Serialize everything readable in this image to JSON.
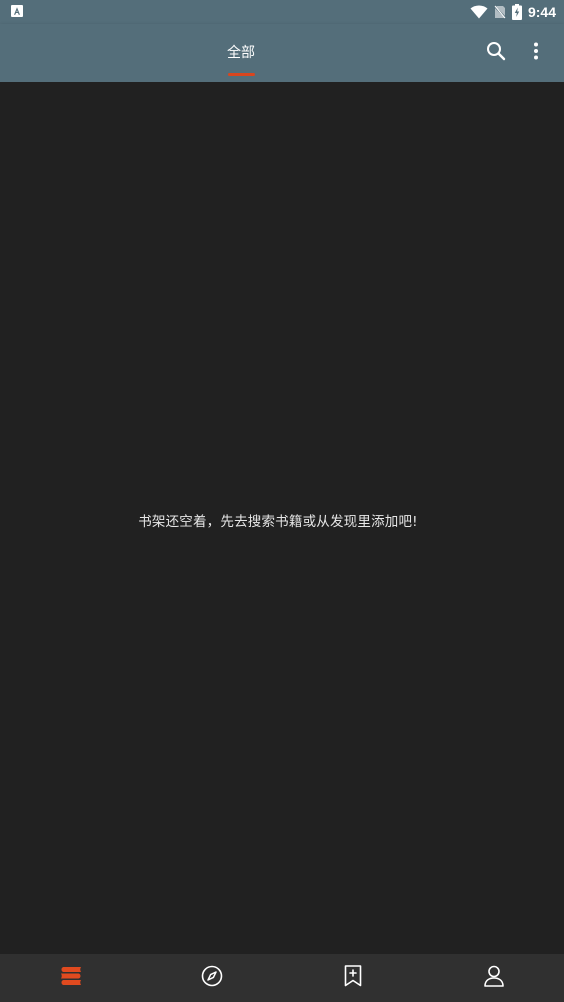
{
  "status_bar": {
    "time": "9:44",
    "left_icon": "a-notification-icon",
    "icons": [
      "wifi-icon",
      "no-sim-icon",
      "battery-charging-icon"
    ]
  },
  "app_bar": {
    "tab_label": "全部",
    "actions": [
      "search-icon",
      "more-vert-icon"
    ],
    "background_color": "#546e7a",
    "indicator_color": "#d9461f"
  },
  "content": {
    "empty_message": "书架还空着，先去搜索书籍或从发现里添加吧!"
  },
  "bottom_nav": {
    "items": [
      {
        "icon": "bookshelf-icon",
        "active": true
      },
      {
        "icon": "compass-icon",
        "active": false
      },
      {
        "icon": "bookmark-add-icon",
        "active": false
      },
      {
        "icon": "person-icon",
        "active": false
      }
    ],
    "active_color": "#e04a1f",
    "inactive_color": "#ffffff"
  }
}
